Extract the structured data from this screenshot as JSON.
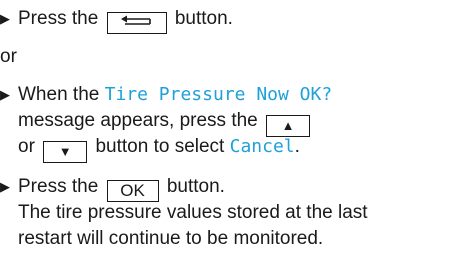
{
  "steps": {
    "step1": {
      "pre": "Press the",
      "key_icon": "back-icon",
      "post": "button."
    },
    "or_text": "or",
    "step2": {
      "pre": "When the",
      "message": "Tire Pressure Now OK?",
      "line2": "message appears, press the",
      "key_up": "▲",
      "line3_pre": "or",
      "key_down": "▼",
      "line3_mid": "button to select",
      "cancel": "Cancel",
      "line3_end": "."
    },
    "step3": {
      "pre": "Press the",
      "key": "OK",
      "post": "button.",
      "note_line1": "The tire pressure values stored at the last",
      "note_line2": "restart will continue to be monitored."
    }
  },
  "colors": {
    "highlight": "#1ea1d8",
    "text": "#1a1a1a"
  }
}
